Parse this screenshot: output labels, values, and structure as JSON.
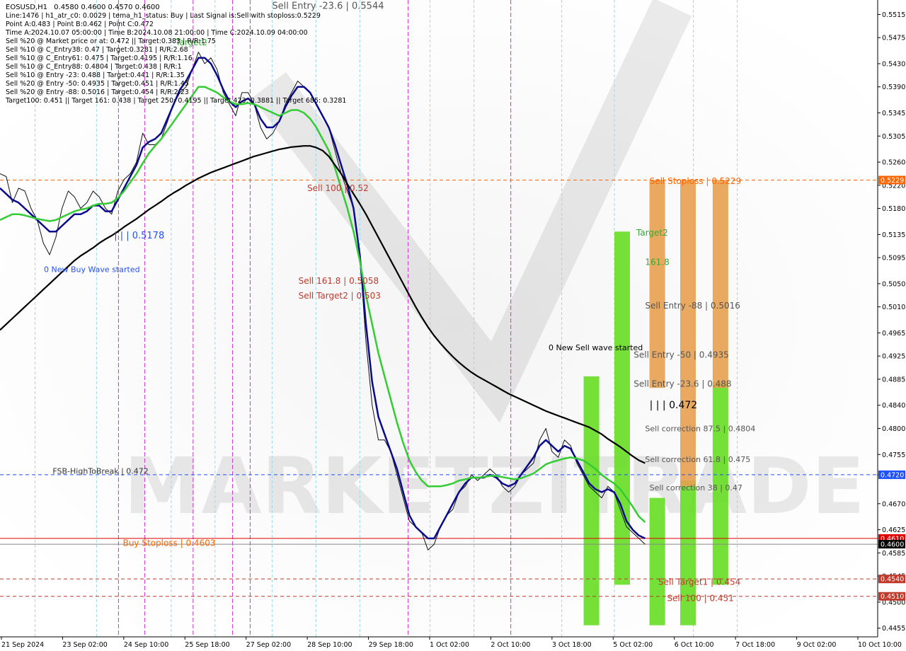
{
  "chart_data": {
    "type": "line",
    "symbol": "EOSUSD,H1",
    "ohlc": "0.4580 0.4600 0.4570 0.4600",
    "info_lines": [
      "Line:1476 | h1_atr_c0: 0.0029 | tema_h1_status: Buy | Last Signal is:Sell with stoploss:0.5229",
      "Point A:0.483 | Point B:0.462 | Point C:0.472",
      "Time A:2024.10.07 05:00:00 | Time B:2024.10.08 21:00:00 | Time C:2024.10.09 04:00:00",
      "Sell %20 @ Market price or at: 0.472 || Target:0.383 | R/R:1.75",
      "Sell %10 @ C_Entry38: 0.47 | Target:0.3281 | R/R:2.68",
      "Sell %10 @ C_Entry61: 0.475 | Target:0.4195 | R/R:1.16",
      "Sell %10 @ C_Entry88: 0.4804 | Target:0.438 | R/R:1",
      "Sell %10 @ Entry -23: 0.488 | Target:0.441 | R/R:1.35",
      "Sell %20 @ Entry -50: 0.4935 | Target:0.451 | R/R:1.45",
      "Sell %20 @ Entry -88: 0.5016 | Target:0.454 | R/R:2.23",
      "Target100: 0.451 || Target 161: 0.438 | Target 250: 0.4195 || Target 423: 0.3881 || Target 685: 0.3281"
    ],
    "x_labels": [
      "21 Sep 2024",
      "23 Sep 02:00",
      "24 Sep 10:00",
      "25 Sep 18:00",
      "27 Sep 02:00",
      "28 Sep 10:00",
      "29 Sep 18:00",
      "1 Oct 02:00",
      "2 Oct 10:00",
      "3 Oct 18:00",
      "5 Oct 02:00",
      "6 Oct 10:00",
      "7 Oct 18:00",
      "9 Oct 02:00",
      "10 Oct 10:00"
    ],
    "y_ticks": [
      "0.5515",
      "0.5475",
      "0.5430",
      "0.5390",
      "0.5345",
      "0.5305",
      "0.5260",
      "0.5220",
      "0.5180",
      "0.5135",
      "0.5095",
      "0.5050",
      "0.5010",
      "0.4965",
      "0.4925",
      "0.4885",
      "0.4840",
      "0.4800",
      "0.4755",
      "0.4720",
      "0.4670",
      "0.4625",
      "0.4585",
      "0.4545",
      "0.4500",
      "0.4455"
    ],
    "ylim": [
      0.444,
      0.554
    ],
    "price_badges": [
      {
        "text": "0.5229",
        "value": 0.5229,
        "color": "#ff6600"
      },
      {
        "text": "0.4720",
        "value": 0.472,
        "color": "#1e50ff"
      },
      {
        "text": "0.4610",
        "value": 0.461,
        "color": "#e00000"
      },
      {
        "text": "0.4600",
        "value": 0.46,
        "color": "#000000"
      },
      {
        "text": "0.4540",
        "value": 0.454,
        "color": "#c0392b"
      },
      {
        "text": "0.4510",
        "value": 0.451,
        "color": "#c0392b"
      }
    ],
    "hlines": [
      {
        "value": 0.5229,
        "color": "#ff6600",
        "style": "dashed"
      },
      {
        "value": 0.472,
        "color": "#1e50ff",
        "style": "dashed"
      },
      {
        "value": 0.461,
        "color": "#e00000",
        "style": "solid"
      },
      {
        "value": 0.46,
        "color": "#888888",
        "style": "solid"
      },
      {
        "value": 0.454,
        "color": "#c0392b",
        "style": "dashed"
      },
      {
        "value": 0.451,
        "color": "#c0392b",
        "style": "dashed"
      }
    ],
    "series": [
      {
        "name": "price",
        "color": "#111111",
        "values": [
          0.524,
          0.5235,
          0.519,
          0.5215,
          0.521,
          0.518,
          0.516,
          0.512,
          0.51,
          0.513,
          0.518,
          0.521,
          0.52,
          0.518,
          0.519,
          0.521,
          0.52,
          0.518,
          0.517,
          0.521,
          0.523,
          0.524,
          0.526,
          0.531,
          0.529,
          0.529,
          0.53,
          0.533,
          0.536,
          0.538,
          0.539,
          0.542,
          0.545,
          0.543,
          0.544,
          0.542,
          0.538,
          0.536,
          0.534,
          0.538,
          0.538,
          0.536,
          0.532,
          0.53,
          0.531,
          0.533,
          0.536,
          0.538,
          0.54,
          0.539,
          0.538,
          0.536,
          0.534,
          0.532,
          0.528,
          0.524,
          0.521,
          0.518,
          0.51,
          0.495,
          0.484,
          0.478,
          0.478,
          0.476,
          0.472,
          0.468,
          0.464,
          0.463,
          0.462,
          0.459,
          0.46,
          0.463,
          0.465,
          0.466,
          0.469,
          0.47,
          0.472,
          0.471,
          0.472,
          0.473,
          0.472,
          0.47,
          0.469,
          0.47,
          0.472,
          0.473,
          0.474,
          0.478,
          0.48,
          0.476,
          0.475,
          0.478,
          0.477,
          0.474,
          0.472,
          0.47,
          0.469,
          0.468,
          0.47,
          0.469,
          0.466,
          0.463,
          0.462,
          0.461,
          0.46
        ]
      },
      {
        "name": "tema_fast",
        "color": "#0a0a8c",
        "values": [
          0.5215,
          0.5205,
          0.5195,
          0.519,
          0.518,
          0.517,
          0.516,
          0.515,
          0.514,
          0.514,
          0.515,
          0.516,
          0.517,
          0.517,
          0.5175,
          0.5185,
          0.5185,
          0.5175,
          0.5175,
          0.5195,
          0.5215,
          0.5235,
          0.5255,
          0.5285,
          0.5295,
          0.53,
          0.531,
          0.5335,
          0.536,
          0.5385,
          0.54,
          0.542,
          0.544,
          0.544,
          0.543,
          0.541,
          0.5385,
          0.5365,
          0.5355,
          0.5365,
          0.537,
          0.536,
          0.5335,
          0.532,
          0.532,
          0.533,
          0.5355,
          0.5375,
          0.539,
          0.539,
          0.538,
          0.536,
          0.534,
          0.532,
          0.529,
          0.5255,
          0.522,
          0.518,
          0.51,
          0.498,
          0.488,
          0.482,
          0.479,
          0.476,
          0.473,
          0.469,
          0.465,
          0.463,
          0.462,
          0.461,
          0.461,
          0.463,
          0.465,
          0.467,
          0.469,
          0.4705,
          0.4715,
          0.4715,
          0.4715,
          0.472,
          0.4715,
          0.4705,
          0.47,
          0.4705,
          0.472,
          0.4735,
          0.475,
          0.477,
          0.478,
          0.477,
          0.476,
          0.477,
          0.4765,
          0.4745,
          0.4725,
          0.4705,
          0.4695,
          0.469,
          0.4695,
          0.469,
          0.467,
          0.464,
          0.4625,
          0.4615,
          0.461
        ]
      },
      {
        "name": "ma_mid",
        "color": "#33cc33",
        "values": [
          0.516,
          0.5165,
          0.517,
          0.517,
          0.5168,
          0.5165,
          0.5162,
          0.516,
          0.5158,
          0.516,
          0.5165,
          0.517,
          0.5175,
          0.5178,
          0.518,
          0.5185,
          0.5188,
          0.5188,
          0.519,
          0.5198,
          0.521,
          0.5225,
          0.524,
          0.5258,
          0.5275,
          0.5288,
          0.53,
          0.5315,
          0.533,
          0.5345,
          0.536,
          0.5375,
          0.539,
          0.539,
          0.5385,
          0.538,
          0.5372,
          0.5365,
          0.536,
          0.536,
          0.5362,
          0.536,
          0.5355,
          0.535,
          0.5345,
          0.534,
          0.5345,
          0.535,
          0.535,
          0.5345,
          0.5335,
          0.532,
          0.53,
          0.528,
          0.525,
          0.5215,
          0.518,
          0.514,
          0.509,
          0.503,
          0.498,
          0.493,
          0.489,
          0.485,
          0.481,
          0.4775,
          0.4745,
          0.4725,
          0.471,
          0.47,
          0.47,
          0.47,
          0.4702,
          0.4705,
          0.471,
          0.4712,
          0.4715,
          0.4715,
          0.4716,
          0.4718,
          0.4718,
          0.4716,
          0.4714,
          0.4712,
          0.4714,
          0.4718,
          0.4722,
          0.473,
          0.4738,
          0.4742,
          0.4745,
          0.4748,
          0.475,
          0.4748,
          0.4745,
          0.4738,
          0.473,
          0.472,
          0.4712,
          0.4705,
          0.4695,
          0.468,
          0.4665,
          0.4648,
          0.4638
        ]
      },
      {
        "name": "ma_slow",
        "color": "#000000",
        "values": [
          0.497,
          0.498,
          0.499,
          0.5,
          0.501,
          0.502,
          0.503,
          0.504,
          0.505,
          0.506,
          0.507,
          0.508,
          0.509,
          0.5098,
          0.5105,
          0.5112,
          0.512,
          0.5127,
          0.5133,
          0.514,
          0.5148,
          0.5155,
          0.5162,
          0.517,
          0.5178,
          0.5185,
          0.5192,
          0.52,
          0.5207,
          0.5213,
          0.522,
          0.5226,
          0.5232,
          0.5237,
          0.5242,
          0.5246,
          0.525,
          0.5254,
          0.5258,
          0.5262,
          0.5266,
          0.527,
          0.5273,
          0.5276,
          0.5279,
          0.5282,
          0.5284,
          0.5286,
          0.5287,
          0.5288,
          0.5288,
          0.5285,
          0.528,
          0.527,
          0.5255,
          0.524,
          0.5222,
          0.5205,
          0.5188,
          0.517,
          0.515,
          0.513,
          0.511,
          0.509,
          0.507,
          0.505,
          0.503,
          0.501,
          0.4992,
          0.4975,
          0.496,
          0.4947,
          0.4935,
          0.4924,
          0.4914,
          0.4905,
          0.4897,
          0.489,
          0.4884,
          0.4878,
          0.4872,
          0.4866,
          0.486,
          0.4855,
          0.485,
          0.4845,
          0.484,
          0.4835,
          0.483,
          0.4826,
          0.4822,
          0.4818,
          0.4814,
          0.481,
          0.4806,
          0.4802,
          0.4796,
          0.479,
          0.4782,
          0.4775,
          0.4768,
          0.476,
          0.4752,
          0.4745,
          0.474
        ]
      }
    ],
    "bands": [
      {
        "color": "#66dd22",
        "x": 0.665,
        "low": 0.446,
        "high": 0.489
      },
      {
        "color": "#66dd22",
        "x": 0.7,
        "low": 0.453,
        "high": 0.514
      },
      {
        "color": "#66dd22",
        "x": 0.74,
        "low": 0.446,
        "high": 0.468
      },
      {
        "color": "#66dd22",
        "x": 0.775,
        "low": 0.446,
        "high": 0.471
      },
      {
        "color": "#66dd22",
        "x": 0.812,
        "low": 0.453,
        "high": 0.488
      },
      {
        "color": "#e8a050",
        "x": 0.74,
        "low": 0.487,
        "high": 0.5229
      },
      {
        "color": "#e8a050",
        "x": 0.775,
        "low": 0.47,
        "high": 0.5229
      },
      {
        "color": "#e8a050",
        "x": 0.812,
        "low": 0.487,
        "high": 0.5229
      }
    ],
    "annotations": [
      {
        "text": "Sell Entry -23.6 | 0.5544",
        "value": 0.5525,
        "x": 0.31,
        "color": "#555555",
        "size": 13
      },
      {
        "text": "Target2",
        "value": 0.5462,
        "x": 0.2,
        "color": "#33aa33",
        "size": 12
      },
      {
        "text": "Sell 100 | 0.52",
        "value": 0.521,
        "x": 0.35,
        "color": "#c0392b",
        "size": 12
      },
      {
        "text": "| | | 0.5178",
        "value": 0.5128,
        "x": 0.13,
        "color": "#1e50ff",
        "size": 13
      },
      {
        "text": "0 New Buy Wave started",
        "value": 0.507,
        "x": 0.05,
        "color": "#1e50ff",
        "size": 11
      },
      {
        "text": "Sell 161.8 | 0.5058",
        "value": 0.505,
        "x": 0.34,
        "color": "#c0392b",
        "size": 12
      },
      {
        "text": "Sell Target2 | 0.503",
        "value": 0.5024,
        "x": 0.34,
        "color": "#c0392b",
        "size": 12
      },
      {
        "text": "Sell Stoploss | 0.5229",
        "value": 0.5222,
        "x": 0.74,
        "color": "#ff6600",
        "size": 12
      },
      {
        "text": "Target2",
        "value": 0.5133,
        "x": 0.725,
        "color": "#33aa33",
        "size": 12
      },
      {
        "text": "161.8",
        "value": 0.5082,
        "x": 0.735,
        "color": "#33aa33",
        "size": 12
      },
      {
        "text": "Sell Entry -88 | 0.5016",
        "value": 0.5007,
        "x": 0.735,
        "color": "#555555",
        "size": 12
      },
      {
        "text": "0 New Sell wave started",
        "value": 0.4935,
        "x": 0.625,
        "color": "#000000",
        "size": 11
      },
      {
        "text": "Sell Entry -50 | 0.4935",
        "value": 0.4922,
        "x": 0.722,
        "color": "#555555",
        "size": 12
      },
      {
        "text": "Sell Entry -23.6 | 0.488",
        "value": 0.4872,
        "x": 0.722,
        "color": "#555555",
        "size": 12
      },
      {
        "text": "| | | 0.472",
        "value": 0.4835,
        "x": 0.74,
        "color": "#000000",
        "size": 14
      },
      {
        "text": "Sell correction 87.5 | 0.4804",
        "value": 0.4795,
        "x": 0.735,
        "color": "#555555",
        "size": 11
      },
      {
        "text": "Sell correction 61.8 | 0.475",
        "value": 0.4742,
        "x": 0.735,
        "color": "#555555",
        "size": 11
      },
      {
        "text": "Sell correction 38 | 0.47",
        "value": 0.4693,
        "x": 0.74,
        "color": "#555555",
        "size": 11
      },
      {
        "text": "FSB-HighToBreak | 0.472",
        "value": 0.4722,
        "x": 0.06,
        "color": "#333333",
        "size": 11
      },
      {
        "text": "Buy Stoploss | 0.4603",
        "value": 0.4597,
        "x": 0.14,
        "color": "#ff6600",
        "size": 12
      },
      {
        "text": "Sell Target1 | 0.454",
        "value": 0.453,
        "x": 0.75,
        "color": "#c0392b",
        "size": 12
      },
      {
        "text": "Sell 100 | 0.451",
        "value": 0.4502,
        "x": 0.76,
        "color": "#c0392b",
        "size": 12
      }
    ],
    "magenta_vlines": [
      0.135,
      0.165,
      0.22,
      0.265,
      0.285,
      0.465,
      0.582
    ],
    "cyan_vlines": [
      0.04,
      0.11,
      0.195,
      0.245,
      0.31,
      0.36,
      0.41,
      0.49,
      0.54,
      0.64,
      0.7,
      0.79,
      0.84
    ]
  }
}
